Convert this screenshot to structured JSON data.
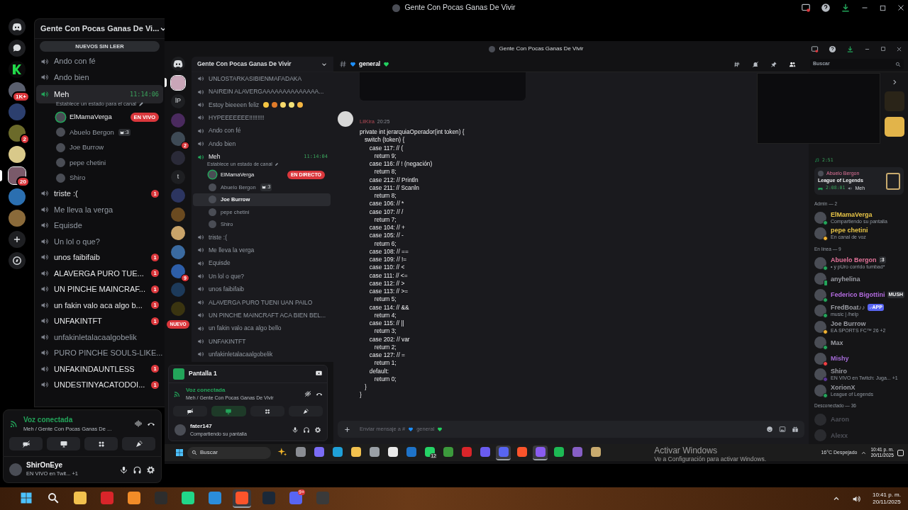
{
  "window": {
    "title": "Gente Con Pocas Ganas De Vivir"
  },
  "servers": [
    {
      "kind": "home",
      "selected": false
    },
    {
      "kind": "dms",
      "selected": false
    },
    {
      "kind": "server",
      "selected": false,
      "color": "#0b0b0b"
    },
    {
      "kind": "server",
      "selected": false,
      "color": "#5a5f6e",
      "badge": "1K+"
    },
    {
      "kind": "server",
      "selected": false,
      "color": "#2c3f6e"
    },
    {
      "kind": "server",
      "selected": false,
      "color": "#6b6a2a",
      "badge": "2"
    },
    {
      "kind": "server",
      "selected": false,
      "color": "#d9c98a"
    },
    {
      "kind": "server",
      "selected": true,
      "color": "#7a5a6a",
      "badge": "20"
    },
    {
      "kind": "server",
      "selected": false,
      "color": "#2b6fb0"
    },
    {
      "kind": "server",
      "selected": false,
      "color": "#8a6a3a"
    },
    {
      "kind": "add",
      "selected": false
    },
    {
      "kind": "discover",
      "selected": false
    }
  ],
  "channel_panel": {
    "title": "Gente Con Pocas Ganas De Vi...",
    "unread_pill": "NUEVOS SIN LEER",
    "channels": [
      {
        "name": "Ando con fé",
        "selected": false,
        "connected": false
      },
      {
        "name": "Ando bien",
        "selected": false,
        "connected": false
      },
      {
        "name": "Meh",
        "selected": true,
        "connected": true,
        "timer": "11:14:06",
        "status": "Establece un estado para el canal",
        "members": [
          {
            "name": "ElMamaVerga",
            "speaking": true,
            "live": "EN VIVO"
          },
          {
            "name": "Abuelo Bergon",
            "speaking": false,
            "tag": ":3"
          },
          {
            "name": "Joe Burrow",
            "speaking": false
          },
          {
            "name": "pepe chetini",
            "speaking": false
          },
          {
            "name": "Shiro",
            "speaking": false
          }
        ]
      },
      {
        "name": "triste :(",
        "selected": false,
        "connected": false,
        "badge": "1"
      },
      {
        "name": "Me lleva la verga",
        "selected": false,
        "connected": false
      },
      {
        "name": "Equisde",
        "selected": false,
        "connected": false
      },
      {
        "name": "Un lol o que?",
        "selected": false,
        "connected": false
      },
      {
        "name": "unos faibifaib",
        "selected": false,
        "connected": false,
        "badge": "1"
      },
      {
        "name": "ALAVERGA PURO TUE...",
        "selected": false,
        "connected": false,
        "badge": "1"
      },
      {
        "name": "UN PINCHE MAINCRAF...",
        "selected": false,
        "connected": false,
        "badge": "1"
      },
      {
        "name": "un fakin valo aca algo b...",
        "selected": false,
        "connected": false,
        "badge": "1"
      },
      {
        "name": "UNFAKINTFT",
        "selected": false,
        "connected": false,
        "badge": "1"
      },
      {
        "name": "unfakinletalacaalgobelik",
        "selected": false,
        "connected": false
      },
      {
        "name": "PURO PINCHE SOULS-LIKE...",
        "selected": false,
        "connected": false
      },
      {
        "name": "UNFAKINDAUNTLESS",
        "selected": false,
        "connected": false,
        "badge": "1"
      },
      {
        "name": "UNDESTINYACATODOI...",
        "selected": false,
        "connected": false,
        "badge": "1"
      }
    ]
  },
  "voice_panel": {
    "status": "Voz conectada",
    "location": "Meh / Gente Con Pocas Ganas De ...",
    "buttons": [
      {
        "kind": "camera",
        "active": false
      },
      {
        "kind": "screen",
        "active": false
      },
      {
        "kind": "activities",
        "active": false
      },
      {
        "kind": "soundboard",
        "active": false
      }
    ]
  },
  "user_panel": {
    "name": "ShirOnEye",
    "activity": "EN VIVO en Twit... +1"
  },
  "stream": {
    "window_title": "Gente Con Pocas Ganas De Vivir",
    "servers": [
      {
        "kind": "home",
        "selected": false
      },
      {
        "kind": "server",
        "selected": true,
        "color": "#c9a6b8"
      },
      {
        "kind": "server",
        "selected": false,
        "label": "lP",
        "color": "#1e1f22"
      },
      {
        "kind": "server",
        "selected": false,
        "color": "#4a2a5e"
      },
      {
        "kind": "server",
        "selected": false,
        "color": "#3e4a55",
        "badge": "2"
      },
      {
        "kind": "server",
        "selected": false,
        "color": "#2a2a38"
      },
      {
        "kind": "server",
        "selected": false,
        "label": "t",
        "color": "#1e1f22"
      },
      {
        "kind": "server",
        "selected": false,
        "color": "#2c3560"
      },
      {
        "kind": "server",
        "selected": false,
        "color": "#6a4a20"
      },
      {
        "kind": "server",
        "selected": false,
        "color": "#c9a46a"
      },
      {
        "kind": "server",
        "selected": false,
        "color": "#3a6aa0"
      },
      {
        "kind": "server",
        "selected": false,
        "color": "#2d5ea8",
        "badge": "9"
      },
      {
        "kind": "server",
        "selected": false,
        "color": "#1d3a5a"
      },
      {
        "kind": "server",
        "selected": false,
        "color": "#3a3410"
      },
      {
        "kind": "new",
        "selected": false,
        "label": "NUEVO"
      }
    ],
    "channel_panel": {
      "title": "Gente Con Pocas Ganas De Vivir",
      "channels": [
        {
          "name": "UNLOSTARKASIBIENMAFADAKA",
          "selected": false,
          "connected": false
        },
        {
          "name": "NAIREIN ALAVERGAAAAAAAAAAAAAA...",
          "selected": false,
          "connected": false
        },
        {
          "name": "Estoy bieeeen feliz",
          "selected": false,
          "connected": false,
          "emoji": [
            {
              "color": "#f5c542"
            },
            {
              "color": "#e07b2a"
            },
            {
              "color": "#f7d96b"
            },
            {
              "color": "#f3e27a"
            },
            {
              "color": "#f5b642"
            }
          ]
        },
        {
          "name": "HYPEEEEEEE!!!!!!!!!",
          "selected": false,
          "connected": false
        },
        {
          "name": "Ando con fé",
          "selected": false,
          "connected": false
        },
        {
          "name": "Ando bien",
          "selected": false,
          "connected": false
        },
        {
          "name": "Meh",
          "selected": false,
          "connected": true,
          "timer": "11:14:04",
          "status": "Establece un estado de canal",
          "members": [
            {
              "name": "ElMamaVerga",
              "speaking": true,
              "hovered": false,
              "live": "EN DIRECTO"
            },
            {
              "name": "Abuelo Bergon",
              "speaking": false,
              "hovered": false,
              "tag": ":3"
            },
            {
              "name": "Joe Burrow",
              "speaking": false,
              "hovered": true
            },
            {
              "name": "pepe chetini",
              "speaking": false,
              "hovered": false
            },
            {
              "name": "Shiro",
              "speaking": false,
              "hovered": false
            }
          ]
        },
        {
          "name": "triste :(",
          "selected": false,
          "connected": false
        },
        {
          "name": "Me lleva la verga",
          "selected": false,
          "connected": false
        },
        {
          "name": "Equisde",
          "selected": false,
          "connected": false
        },
        {
          "name": "Un lol o que?",
          "selected": false,
          "connected": false
        },
        {
          "name": "unos faibifaib",
          "selected": false,
          "connected": false
        },
        {
          "name": "ALAVERGA PURO TUENI UAN PAILO",
          "selected": false,
          "connected": false
        },
        {
          "name": "UN PINCHE MAINCRAFT ACA BIEN BEL...",
          "selected": false,
          "connected": false
        },
        {
          "name": "un fakin valo aca algo bello",
          "selected": false,
          "connected": false
        },
        {
          "name": "UNFAKINTFT",
          "selected": false,
          "connected": false
        },
        {
          "name": "unfakinletalacaalgobelik",
          "selected": false,
          "connected": false
        }
      ]
    },
    "stream_panel": {
      "title": "Pantalla 1"
    },
    "voice_panel": {
      "status": "Voz conectada",
      "location": "Meh / Gente Con Pocas Ganas De Vivir",
      "buttons": [
        {
          "kind": "camera",
          "active": false
        },
        {
          "kind": "screen",
          "active": true
        },
        {
          "kind": "activities",
          "active": false
        },
        {
          "kind": "soundboard",
          "active": false
        }
      ]
    },
    "user_panel": {
      "name": "fater147",
      "activity": "Compartiendo su pantalla"
    },
    "chat": {
      "channel": "general",
      "search_placeholder": "Buscar",
      "message": {
        "author": "LilKira",
        "time": "20:25",
        "lines": [
          "private int jerarquiaOperador(int token) {",
          "   switch (token) {",
          "      case 117: // (",
          "         return 9;",
          "      case 116: // ! (negación)",
          "         return 8;",
          "      case 212: // Println",
          "      case 211: // Scanln",
          "         return 8;",
          "      case 106: // *",
          "      case 107: // /",
          "         return 7;",
          "      case 104: // +",
          "      case 105: // -",
          "         return 6;",
          "      case 108: // ==",
          "      case 109: // !=",
          "      case 110: // <",
          "      case 111: // <=",
          "      case 112: // >",
          "      case 113: // >=",
          "         return 5;",
          "      case 114: // &&",
          "         return 4;",
          "      case 115: // ||",
          "         return 3;",
          "      case 202: // var",
          "         return 2;",
          "      case 127: // =",
          "         return 1;",
          "      default:",
          "         return 0;",
          "   }",
          "}"
        ]
      },
      "input_prefix": "Enviar mensaje a #",
      "input_channel": "general"
    },
    "members": {
      "activity_cards": [
        {
          "time": "2:51"
        },
        {
          "name": "Abuelo Bergon",
          "game": "League of Legends",
          "time": "2:08:01",
          "channel": "Meh"
        }
      ],
      "groups": [
        {
          "title": "Admin — 2",
          "members": [
            {
              "name": "ElMamaVerga",
              "color": "#e8c547",
              "kind": "online",
              "activity": "Compartiendo su pantalla"
            },
            {
              "name": "pepe chetini",
              "color": "#e8c547",
              "kind": "idle",
              "activity": "En canal de voz"
            }
          ]
        },
        {
          "title": "En línea — 9",
          "members": [
            {
              "name": "Abuelo Bergon",
              "color": "#e3739a",
              "kind": "online",
              "tag": ":3",
              "activity": "• y pUro corrido tumbad*"
            },
            {
              "name": "anyhelina",
              "color": "#9a9ca3",
              "kind": "mobile"
            },
            {
              "name": "Federico Bigottini",
              "color": "#b46be0",
              "kind": "online",
              "tag": "MUSH"
            },
            {
              "name": "FredBoat♪♪",
              "color": "#9a9ca3",
              "kind": "online",
              "app": "APP",
              "activity": "music | /help"
            },
            {
              "name": "Joe Burrow",
              "color": "#9a9ca3",
              "kind": "idle",
              "activity": "EA SPORTS FC™ 26 +2"
            },
            {
              "name": "Max",
              "color": "#9a9ca3",
              "kind": "online"
            },
            {
              "name": "Mishy",
              "color": "#a46bd6",
              "kind": "dnd"
            },
            {
              "name": "Shiro",
              "color": "#9a9ca3",
              "kind": "streaming",
              "activity": "EN VIVO en Twitch: Juga... +1"
            },
            {
              "name": "XorionX",
              "color": "#9a9ca3",
              "kind": "online",
              "activity": "League of Legends"
            }
          ]
        },
        {
          "title": "Desconectado — 36",
          "members": [
            {
              "name": "Aaron",
              "color": "#4e5058",
              "kind": "offline"
            },
            {
              "name": "Alexx",
              "color": "#4e5058",
              "kind": "offline"
            }
          ]
        }
      ]
    },
    "taskbar": {
      "search_placeholder": "Buscar",
      "apps": [
        {
          "kind": "copilot",
          "color": "#f0b429",
          "active": false
        },
        {
          "kind": "app",
          "color": "#8a8d93",
          "active": false
        },
        {
          "kind": "app",
          "color": "#7b6cf6",
          "active": false
        },
        {
          "kind": "app",
          "color": "#1fa0d8",
          "active": false
        },
        {
          "kind": "app",
          "color": "#f2c14e",
          "active": false
        },
        {
          "kind": "app",
          "color": "#9aa0a6",
          "active": false
        },
        {
          "kind": "app",
          "color": "#e9e9e9",
          "active": false
        },
        {
          "kind": "app",
          "color": "#1e73c8",
          "active": false
        },
        {
          "kind": "app",
          "color": "#25d366",
          "active": false,
          "badge": "12"
        },
        {
          "kind": "app",
          "color": "#3c9a3c",
          "active": false
        },
        {
          "kind": "app",
          "color": "#d9252a",
          "active": false
        },
        {
          "kind": "app",
          "color": "#6a5cf0",
          "active": false
        },
        {
          "kind": "app",
          "color": "#5865f2",
          "active": true
        },
        {
          "kind": "app",
          "color": "#fb542b",
          "active": false
        },
        {
          "kind": "app",
          "color": "#8a5cf0",
          "active": true
        },
        {
          "kind": "app",
          "color": "#1db954",
          "active": false
        },
        {
          "kind": "app",
          "color": "#865fc5",
          "active": false
        },
        {
          "kind": "app",
          "color": "#c8aa6e",
          "active": false
        }
      ],
      "weather": "16°C  Despejado",
      "time": "10:41 p. m.",
      "date": "20/11/2025"
    },
    "activation_notice": {
      "title": "Activar Windows",
      "hint": "Ve a Configuración para activar Windows."
    }
  },
  "taskbar": {
    "apps": [
      {
        "kind": "start",
        "active": false
      },
      {
        "kind": "search",
        "active": false
      },
      {
        "kind": "app",
        "color": "#f2c14e",
        "active": false
      },
      {
        "kind": "app",
        "color": "#d9252a",
        "active": false
      },
      {
        "kind": "app",
        "color": "#f28c28",
        "active": false
      },
      {
        "kind": "app",
        "color": "#2d2d2d",
        "active": false
      },
      {
        "kind": "app",
        "color": "#21d789",
        "active": false
      },
      {
        "kind": "app",
        "color": "#2b8ddb",
        "active": false
      },
      {
        "kind": "app",
        "color": "#fb542b",
        "active": true
      },
      {
        "kind": "app",
        "color": "#1b2838",
        "active": false
      },
      {
        "kind": "app",
        "color": "#5865f2",
        "active": false,
        "badge": "9+"
      },
      {
        "kind": "app",
        "color": "#3a3a3a",
        "active": false
      }
    ],
    "time": "10:41 p. m.",
    "date": "20/11/2025"
  }
}
